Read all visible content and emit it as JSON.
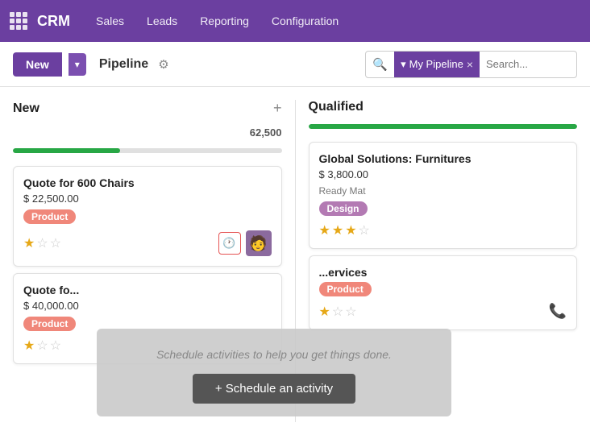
{
  "topnav": {
    "brand": "CRM",
    "items": [
      "Sales",
      "Leads",
      "Reporting",
      "Configuration"
    ]
  },
  "toolbar": {
    "new_label": "New",
    "pipeline_label": "Pipeline",
    "filter_label": "My Pipeline",
    "search_placeholder": "Search..."
  },
  "kanban": {
    "columns": [
      {
        "id": "new",
        "title": "New",
        "amount": "62,500",
        "progress": 40,
        "cards": [
          {
            "title": "Quote for 600 Chairs",
            "amount": "$ 22,500.00",
            "badge": "Product",
            "badge_type": "salmon",
            "stars": 1,
            "has_avatar": true,
            "has_activity": true,
            "activity_active": true
          },
          {
            "title": "Quote fo...",
            "amount": "$ 40,000.00",
            "badge": "Product",
            "badge_type": "salmon",
            "stars": 1,
            "has_avatar": false,
            "has_activity": false,
            "activity_active": false
          }
        ]
      },
      {
        "id": "qualified",
        "title": "Qualified",
        "amount": "",
        "progress": 100,
        "cards": [
          {
            "title": "Global Solutions: Furnitures",
            "amount": "$ 3,800.00",
            "subtitle": "Ready Mat",
            "badge": "Design",
            "badge_type": "purple",
            "stars": 3,
            "has_avatar": false,
            "has_activity": false,
            "activity_active": false,
            "has_phone": false
          },
          {
            "title": "...ervices",
            "amount": "",
            "badge": "Product",
            "badge_type": "salmon",
            "stars": 1,
            "has_avatar": false,
            "has_activity": false,
            "activity_active": false,
            "has_phone": true
          }
        ]
      }
    ]
  },
  "popover": {
    "hint": "Schedule activities to help you get things done.",
    "button_label": "+ Schedule an activity"
  }
}
